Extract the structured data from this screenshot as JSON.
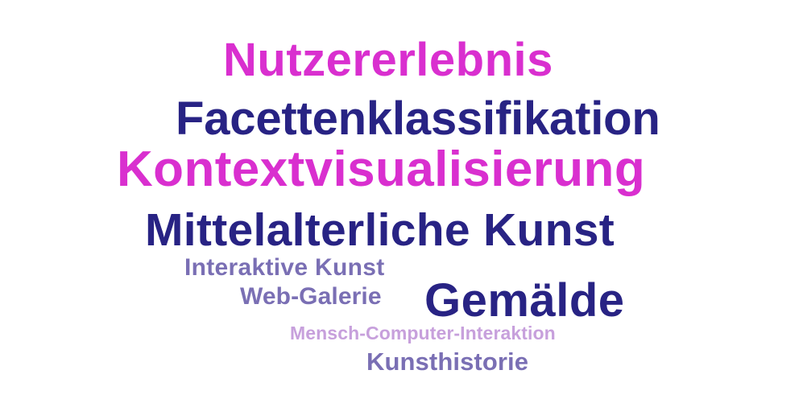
{
  "words": [
    {
      "text": "Nutzererlebnis",
      "color": "#d92fcf"
    },
    {
      "text": "Facettenklassifikation",
      "color": "#282384"
    },
    {
      "text": "Kontextvisualisierung",
      "color": "#d92fcf"
    },
    {
      "text": "Mittelalterliche Kunst",
      "color": "#282384"
    },
    {
      "text": "Interaktive Kunst",
      "color": "#7a6fb4"
    },
    {
      "text": "Web-Galerie",
      "color": "#7a6fb4"
    },
    {
      "text": "Gemälde",
      "color": "#282384"
    },
    {
      "text": "Mensch-Computer-Interaktion",
      "color": "#c7a0dc"
    },
    {
      "text": "Kunsthistorie",
      "color": "#7a6fb4"
    }
  ]
}
